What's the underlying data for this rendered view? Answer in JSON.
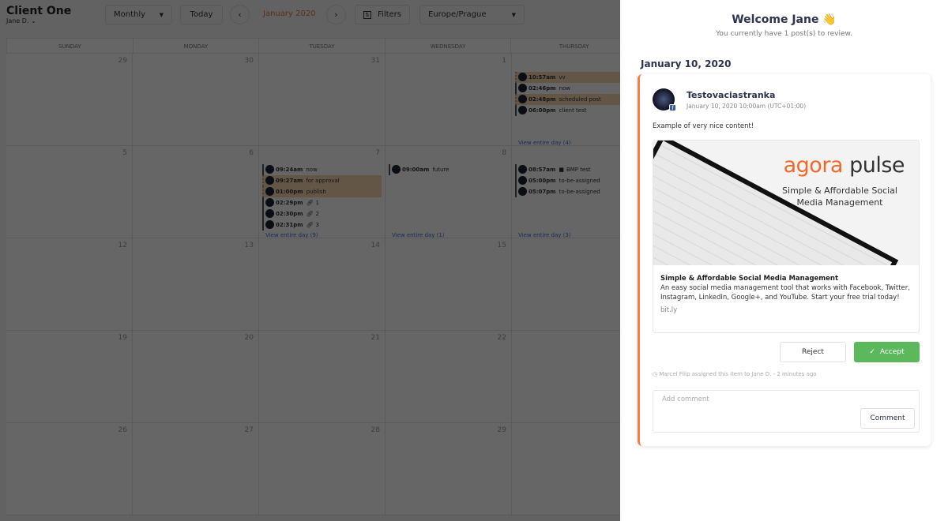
{
  "header": {
    "client": "Client One",
    "user": "Jane D.",
    "view": "Monthly",
    "today": "Today",
    "month": "January 2020",
    "filters": "Filters",
    "timezone": "Europe/Prague",
    "accent": "#e8793a"
  },
  "calendar": {
    "days": [
      "SUNDAY",
      "MONDAY",
      "TUESDAY",
      "WEDNESDAY",
      "THURSDAY"
    ],
    "weeks": [
      [
        {
          "d": "29"
        },
        {
          "d": "30"
        },
        {
          "d": "31"
        },
        {
          "d": "1"
        },
        {
          "d": "",
          "events": [
            {
              "time": "10:57am",
              "label": "vv",
              "hl": true
            },
            {
              "time": "02:46pm",
              "label": "now"
            },
            {
              "time": "02:48pm",
              "label": "scheduled post",
              "hl": true
            },
            {
              "time": "06:00pm",
              "label": "client test"
            }
          ],
          "more": "View entire day (4)"
        }
      ],
      [
        {
          "d": "5"
        },
        {
          "d": "6"
        },
        {
          "d": "7",
          "events": [
            {
              "time": "09:24am",
              "label": "now"
            },
            {
              "time": "09:27am",
              "label": "for approval",
              "hl": true
            },
            {
              "time": "01:00pm",
              "label": "publish",
              "hl": true
            },
            {
              "time": "02:29pm",
              "label": "1",
              "icon": "link"
            },
            {
              "time": "02:30pm",
              "label": "2",
              "icon": "link"
            },
            {
              "time": "02:31pm",
              "label": "3",
              "icon": "link"
            }
          ],
          "more": "View entire day (9)"
        },
        {
          "d": "8",
          "events": [
            {
              "time": "09:00am",
              "label": "future"
            }
          ],
          "more": "View entire day (1)"
        },
        {
          "d": "",
          "events": [
            {
              "time": "08:57am",
              "label": "BMP test",
              "icon": "video"
            },
            {
              "time": "05:00pm",
              "label": "to-be-assigned"
            },
            {
              "time": "05:07pm",
              "label": "to-be-assigned"
            }
          ],
          "more": "View entire day (3)"
        }
      ],
      [
        {
          "d": "12"
        },
        {
          "d": "13"
        },
        {
          "d": "14"
        },
        {
          "d": "15"
        },
        {
          "d": ""
        }
      ],
      [
        {
          "d": "19"
        },
        {
          "d": "20"
        },
        {
          "d": "21"
        },
        {
          "d": "22"
        },
        {
          "d": ""
        }
      ],
      [
        {
          "d": "26"
        },
        {
          "d": "27"
        },
        {
          "d": "28"
        },
        {
          "d": "29"
        },
        {
          "d": ""
        }
      ]
    ]
  },
  "panel": {
    "welcome": "Welcome Jane 👋",
    "subtitle": "You currently have 1 post(s) to review.",
    "date": "January 10, 2020",
    "post": {
      "page": "Testovaciastranka",
      "network": "facebook",
      "datetime": "January 10, 2020 10:00am (UTC+01:00)",
      "text": "Example of very nice content!",
      "image_brand_a": "agora",
      "image_brand_b": " pulse",
      "image_tagline": "Simple & Affordable Social Media Management",
      "link_title": "Simple & Affordable Social Media Management",
      "link_desc": "An easy social media management tool that works with Facebook, Twitter, Instagram, LinkedIn, Google+, and YouTube. Start your free trial today!",
      "link_domain": "bit.ly"
    },
    "reject": "Reject",
    "accept": "Accept",
    "assignment": "Marcel Filip assigned this item to Jane D. - 2 minutes ago",
    "comment_placeholder": "Add comment",
    "comment_button": "Comment",
    "accent": "#f0814f",
    "accept_color": "#5cb85c"
  }
}
